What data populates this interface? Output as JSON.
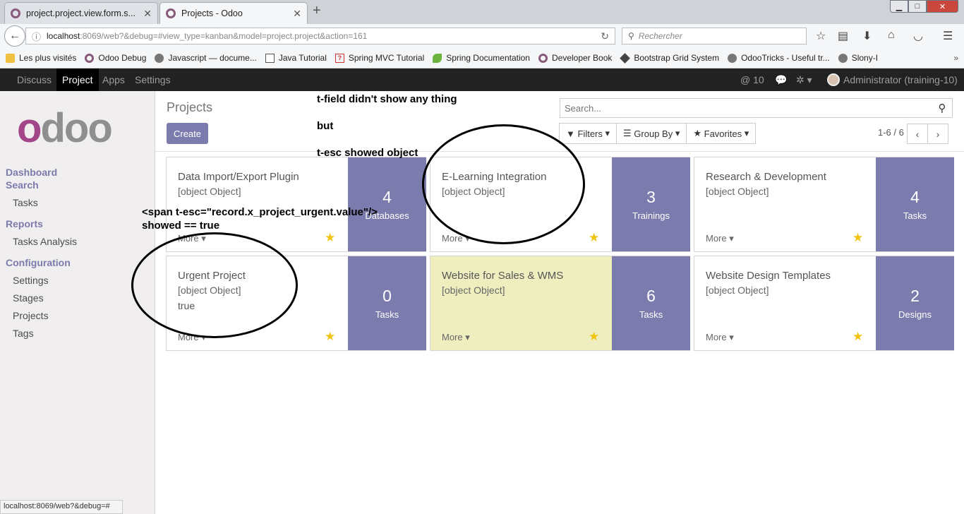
{
  "browser": {
    "tabs": [
      {
        "title": "project.project.view.form.s...",
        "active": false
      },
      {
        "title": "Projects - Odoo",
        "active": true
      }
    ],
    "new_tab": "+",
    "window_controls": {
      "min": "▁",
      "max": "□",
      "close": "✕"
    },
    "url": {
      "host": "localhost",
      "path": ":8069/web?&debug=#view_type=kanban&model=project.project&action=161"
    },
    "search_placeholder": "Rechercher",
    "bookmarks": [
      {
        "label": "Les plus visités",
        "icon": "folder-icon"
      },
      {
        "label": "Odoo Debug",
        "icon": "odoo-icon"
      },
      {
        "label": "Javascript — docume...",
        "icon": "globe-icon"
      },
      {
        "label": "Java Tutorial",
        "icon": "doc-icon"
      },
      {
        "label": "Spring MVC Tutorial",
        "icon": "question-icon"
      },
      {
        "label": "Spring Documentation",
        "icon": "leaf-icon"
      },
      {
        "label": "Developer Book",
        "icon": "odoo-icon"
      },
      {
        "label": "Bootstrap Grid System",
        "icon": "diamond-icon"
      },
      {
        "label": "OdooTricks - Useful tr...",
        "icon": "globe-icon"
      },
      {
        "label": "Slony-I",
        "icon": "globe-icon"
      }
    ],
    "bookmarks_more": "»",
    "status_url": "localhost:8069/web?&debug=#"
  },
  "odoo_menu": {
    "items": [
      "Discuss",
      "Project",
      "Apps",
      "Settings"
    ],
    "active": "Project",
    "mentions": "@ 10",
    "user": "Administrator (training-10)"
  },
  "sidebar": {
    "logo_text": "odoo",
    "sections": [
      {
        "title": "Dashboard",
        "items": []
      },
      {
        "title": "Search",
        "items": [
          "Tasks"
        ]
      },
      {
        "title": "Reports",
        "items": [
          "Tasks Analysis"
        ]
      },
      {
        "title": "Configuration",
        "items": [
          "Settings",
          "Stages",
          "Projects",
          "Tags"
        ]
      }
    ]
  },
  "control_panel": {
    "title": "Projects",
    "create_label": "Create",
    "search_placeholder": "Search...",
    "filters_label": "Filters",
    "groupby_label": "Group By",
    "favorites_label": "Favorites",
    "pager": "1-6 / 6"
  },
  "cards": [
    {
      "name": "Data Import/Export Plugin",
      "object": "[object Object]",
      "extra": "",
      "more": "More",
      "count": "4",
      "label": "Databases",
      "highlight": false
    },
    {
      "name": "E-Learning Integration",
      "object": "[object Object]",
      "extra": "",
      "more": "More",
      "count": "3",
      "label": "Trainings",
      "highlight": false
    },
    {
      "name": "Research & Development",
      "object": "[object Object]",
      "extra": "",
      "more": "More",
      "count": "4",
      "label": "Tasks",
      "highlight": false
    },
    {
      "name": "Urgent Project",
      "object": "[object Object]",
      "extra": "true",
      "more": "More",
      "count": "0",
      "label": "Tasks",
      "highlight": false
    },
    {
      "name": "Website for Sales & WMS",
      "object": "[object Object]",
      "extra": "",
      "more": "More",
      "count": "6",
      "label": "Tasks",
      "highlight": true
    },
    {
      "name": "Website Design Templates",
      "object": "[object Object]",
      "extra": "",
      "more": "More",
      "count": "2",
      "label": "Designs",
      "highlight": false
    }
  ],
  "annotations": {
    "line1": "t-field didn't show any thing",
    "line2": "but",
    "line3": "t-esc showed object",
    "code1": "<span t-esc=\"record.x_project_urgent.value\"/>",
    "code2": "showed == true"
  },
  "colors": {
    "odoo_purple": "#7c7bad",
    "odoo_logo_purple": "#a24689",
    "odoo_logo_gray": "#8f8f8f",
    "menu_dark": "#222222",
    "star_yellow": "#f0c30f",
    "highlight_card": "#eeeebf"
  }
}
